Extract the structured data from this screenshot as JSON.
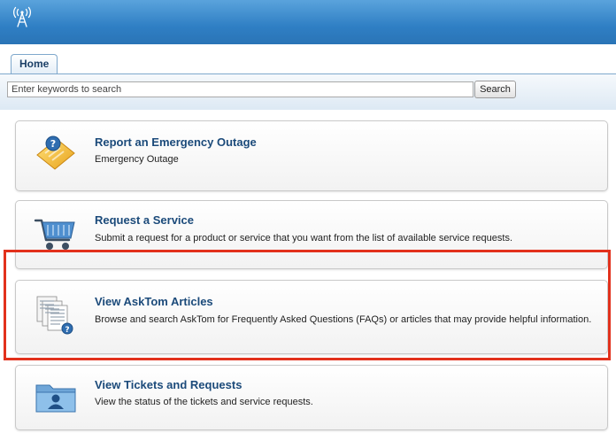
{
  "header": {
    "logo_icon": "radio-tower-icon"
  },
  "tabs": [
    {
      "label": "Home",
      "active": true
    }
  ],
  "search": {
    "placeholder": "Enter keywords to search",
    "button_label": "Search"
  },
  "cards": [
    {
      "title": "Report an Emergency Outage",
      "description": "Emergency Outage",
      "icon": "emergency-ticket-icon"
    },
    {
      "title": "Request a Service",
      "description": "Submit a request for a product or service that you want from the list of available service requests.",
      "icon": "shopping-cart-icon"
    },
    {
      "title": "View AskTom Articles",
      "description": "Browse and search AskTom for Frequently Asked Questions (FAQs) or articles that may provide helpful information.",
      "icon": "articles-icon"
    },
    {
      "title": "View Tickets and Requests",
      "description": "View the status of the tickets and service requests.",
      "icon": "folder-user-icon"
    }
  ],
  "colors": {
    "header": "#3a88cb",
    "title": "#1b4a7a",
    "highlight": "#e2311c"
  }
}
